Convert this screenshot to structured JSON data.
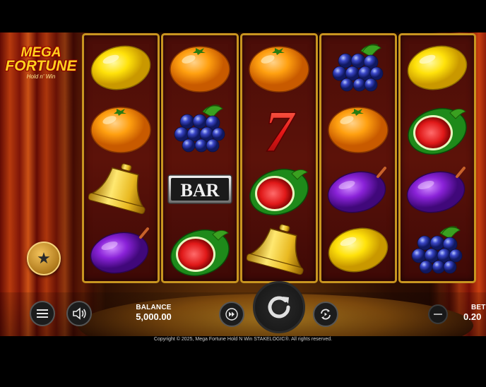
{
  "logo": {
    "line1": "MEGA",
    "line2": "FORTUNE",
    "line3": "Hold n' Win"
  },
  "reels": [
    [
      "lemon-icon",
      "orange-icon",
      "bell-icon",
      "plum-icon"
    ],
    [
      "orange-icon",
      "grapes-icon",
      "bar-icon",
      "watermelon-icon"
    ],
    [
      "orange-icon",
      "seven-icon",
      "watermelon-icon",
      "bell-icon"
    ],
    [
      "grapes-icon",
      "orange-icon",
      "plum-icon",
      "lemon-icon"
    ],
    [
      "lemon-icon",
      "watermelon-icon",
      "plum-icon",
      "grapes-icon"
    ]
  ],
  "symbols": {
    "bar_text": "BAR",
    "seven_text": "7"
  },
  "controls": {
    "balance_label": "BALANCE",
    "balance_value": "5,000.00",
    "bet_label": "BET",
    "bet_value": "0.20"
  },
  "footer": {
    "copyright": "Copyright © 2025, Mega Fortune Hold N Win STAKELOGIC®. All rights reserved."
  },
  "colors": {
    "reel_frame": "#c89520",
    "reel_bg": "#5c1209",
    "logo_text": "#ffd21e"
  }
}
